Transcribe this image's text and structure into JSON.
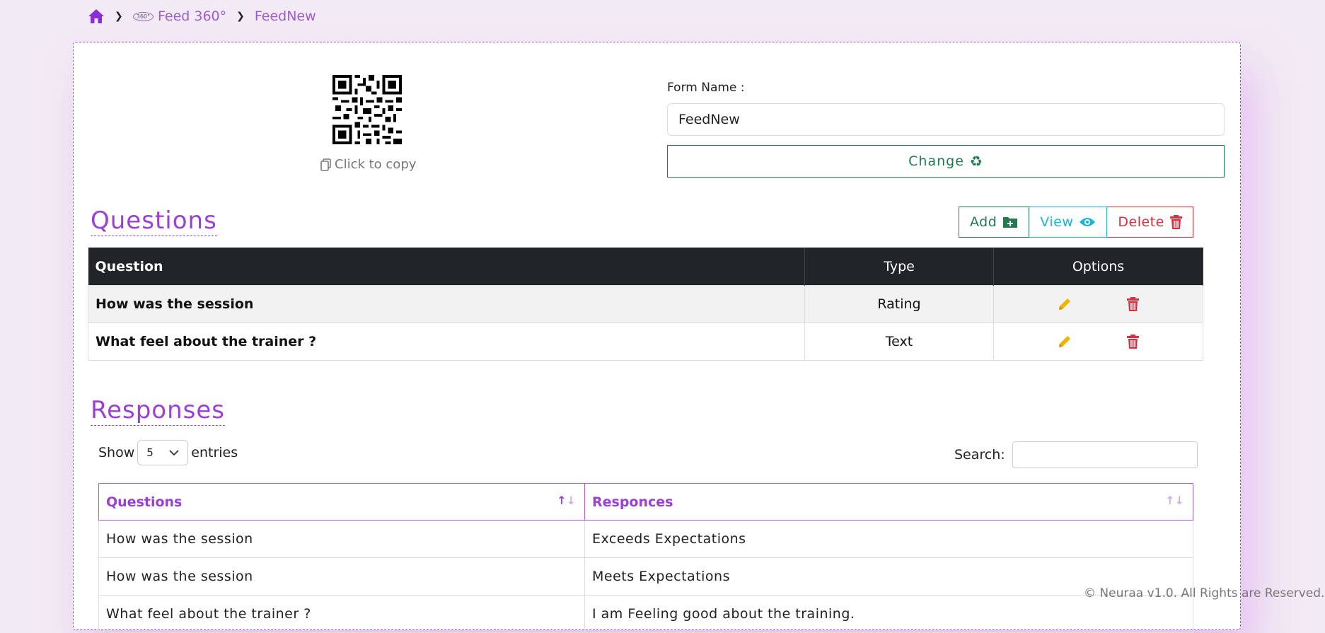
{
  "breadcrumb": {
    "home_icon": "home-icon",
    "logo_text": "360°",
    "parent": "Feed 360°",
    "current": "FeedNew"
  },
  "qr": {
    "copy_label": "Click to copy"
  },
  "form": {
    "label": "Form Name :",
    "value": "FeedNew",
    "change_label": "Change"
  },
  "questions": {
    "title": "Questions",
    "add_label": "Add",
    "view_label": "View",
    "delete_label": "Delete",
    "headers": [
      "Question",
      "Type",
      "Options"
    ],
    "rows": [
      {
        "question": "How was the session",
        "type": "Rating"
      },
      {
        "question": "What feel about the trainer ?",
        "type": "Text"
      }
    ]
  },
  "responses": {
    "title": "Responses",
    "show_label": "Show",
    "entries_value": "5",
    "entries_label": "entries",
    "search_label": "Search:",
    "headers": [
      "Questions",
      "Responces"
    ],
    "rows": [
      {
        "question": "How was the session",
        "response": "Exceeds Expectations"
      },
      {
        "question": "How was the session",
        "response": "Meets Expectations"
      },
      {
        "question": "What feel about the trainer ?",
        "response": "I am Feeling good about the training."
      }
    ]
  },
  "footer": "© Neuraa v1.0. All Rights are Reserved.",
  "colors": {
    "accent": "#9b3fd6",
    "success": "#1f7a4d",
    "info": "#17b6d6",
    "danger": "#dc2f3e",
    "warning": "#f0b400"
  }
}
